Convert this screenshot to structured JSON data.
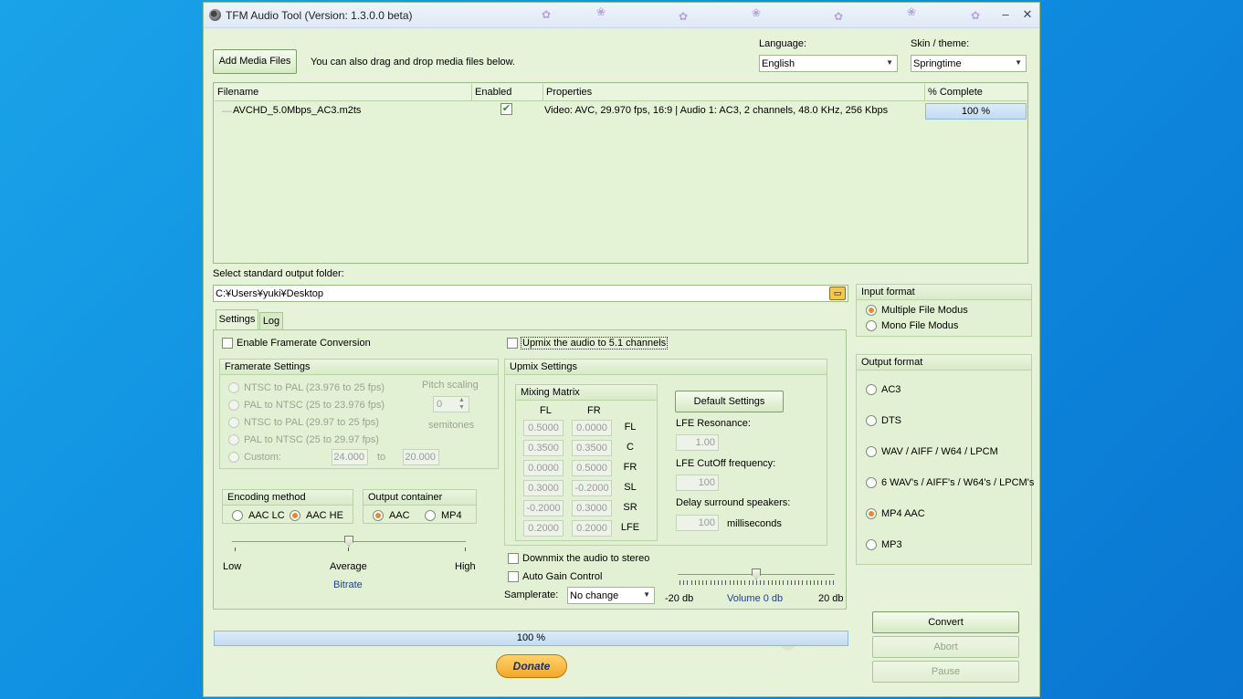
{
  "window": {
    "title": "TFM Audio Tool   (Version: 1.3.0.0 beta)",
    "minimize": "–",
    "close": "✕"
  },
  "top": {
    "add_button": "Add Media Files",
    "drag_hint": "You can also drag and drop media files below.",
    "language_label": "Language:",
    "language_value": "English",
    "skin_label": "Skin / theme:",
    "skin_value": "Springtime"
  },
  "file_grid": {
    "headers": [
      "Filename",
      "Enabled",
      "Properties",
      "% Complete"
    ],
    "rows": [
      {
        "filename": "AVCHD_5.0Mbps_AC3.m2ts",
        "enabled": "✔",
        "properties": "Video: AVC, 29.970 fps, 16:9 | Audio 1: AC3, 2 channels, 48.0 KHz, 256 Kbps",
        "complete": "100 %",
        "complete_fraction": 1.0
      }
    ]
  },
  "output_folder": {
    "label": "Select standard output folder:",
    "value": "C:¥Users¥yuki¥Desktop"
  },
  "tabs": {
    "settings": "Settings",
    "log": "Log"
  },
  "settings": {
    "framerate_checkbox": "Enable Framerate Conversion",
    "upmix_checkbox": "Upmix the audio to 5.1 channels",
    "framerate_group": {
      "title": "Framerate Settings",
      "options": [
        "NTSC to PAL (23.976 to 25 fps)",
        "PAL to NTSC (25 to 23.976 fps)",
        "NTSC to PAL (29.97 to 25 fps)",
        "PAL to NTSC (25 to 29.97 fps)",
        "Custom:"
      ],
      "pitch_label": "Pitch scaling",
      "pitch_value": "0",
      "semitones": "semitones",
      "custom_from": "24.000",
      "custom_to_label": "to",
      "custom_to": "20.000"
    },
    "encoding": {
      "title": "Encoding method",
      "aac_lc": "AAC LC",
      "aac_he": "AAC HE"
    },
    "container": {
      "title": "Output container",
      "aac": "AAC",
      "mp4": "MP4"
    },
    "bitrate": {
      "low": "Low",
      "average": "Average",
      "high": "High",
      "label": "Bitrate",
      "level": 0.5
    },
    "upmix_group": {
      "title": "Upmix Settings",
      "matrix_title": "Mixing Matrix",
      "col_fl": "FL",
      "col_fr": "FR",
      "rows": [
        {
          "fl": "0.5000",
          "fr": "0.0000",
          "label": "FL"
        },
        {
          "fl": "0.3500",
          "fr": "0.3500",
          "label": "C"
        },
        {
          "fl": "0.0000",
          "fr": "0.5000",
          "label": "FR"
        },
        {
          "fl": "0.3000",
          "fr": "-0.2000",
          "label": "SL"
        },
        {
          "fl": "-0.2000",
          "fr": "0.3000",
          "label": "SR"
        },
        {
          "fl": "0.2000",
          "fr": "0.2000",
          "label": "LFE"
        }
      ],
      "default_button": "Default Settings",
      "lfe_resonance_label": "LFE Resonance:",
      "lfe_resonance": "1.00",
      "lfe_cutoff_label": "LFE CutOff frequency:",
      "lfe_cutoff": "100",
      "delay_label": "Delay surround speakers:",
      "delay": "100",
      "delay_unit": "milliseconds"
    },
    "downmix_checkbox": "Downmix the audio to stereo",
    "agc_checkbox": "Auto Gain Control",
    "samplerate_label": "Samplerate:",
    "samplerate_value": "No change",
    "volume": {
      "min": "-20 db",
      "label": "Volume 0 db",
      "max": "20 db",
      "level": 0.5
    }
  },
  "input_format": {
    "title": "Input format",
    "multiple": "Multiple File Modus",
    "mono": "Mono File Modus"
  },
  "output_format": {
    "title": "Output format",
    "options": [
      "AC3",
      "DTS",
      "WAV / AIFF / W64 / LPCM",
      "6 WAV's / AIFF's / W64's / LPCM's",
      "MP4 AAC",
      "MP3"
    ],
    "selected": "MP4 AAC"
  },
  "actions": {
    "convert": "Convert",
    "abort": "Abort",
    "pause": "Pause"
  },
  "overall_progress": {
    "text": "100 %",
    "fraction": 1.0
  },
  "donate": "Donate",
  "colors": {
    "window_bg": "#e6f3d8",
    "accent_radio": "#e9892b",
    "link_blue": "#1c3f9a"
  }
}
